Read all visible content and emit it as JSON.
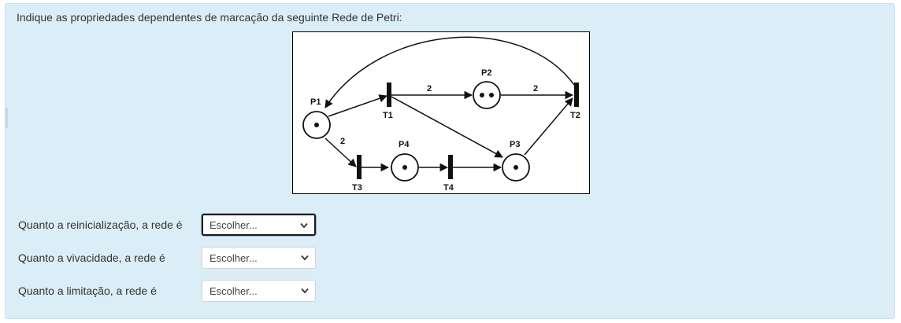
{
  "question": {
    "prompt": "Indique as propriedades dependentes de marcação da seguinte Rede de Petri:"
  },
  "petri_net": {
    "places": [
      "P1",
      "P2",
      "P3",
      "P4"
    ],
    "transitions": [
      "T1",
      "T2",
      "T3",
      "T4"
    ],
    "arc_weights": [
      "2",
      "2",
      "2"
    ]
  },
  "rows": [
    {
      "label": "Quanto a reinicialização, a rede é",
      "select_value": "Escolher..."
    },
    {
      "label": "Quanto a vivacidade, a rede é",
      "select_value": "Escolher..."
    },
    {
      "label": "Quanto a limitação, a rede é",
      "select_value": "Escolher..."
    }
  ],
  "colors": {
    "panel_bg": "#dbedf6",
    "panel_border": "#c7e1ee",
    "focus_border": "#1b1b1b"
  },
  "icons": {
    "select_arrow": "chevron-down-icon"
  }
}
